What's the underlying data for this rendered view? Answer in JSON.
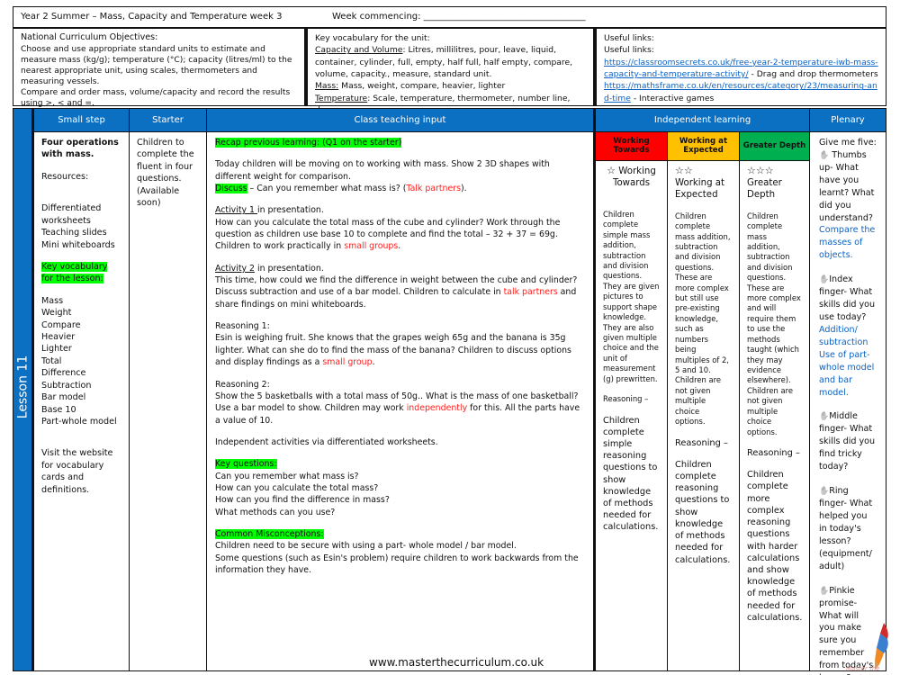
{
  "header": {
    "title": "Year 2 Summer – Mass, Capacity and Temperature week 3",
    "week_commencing_label": "Week commencing: ____________________________________"
  },
  "objectives": {
    "heading": "National Curriculum Objectives:",
    "lines": [
      "Choose and use appropriate standard units to estimate and measure mass (kg/g); temperature (°C); capacity (litres/ml) to the nearest appropriate unit, using scales, thermometers and measuring vessels.",
      "Compare and order mass, volume/capacity and record the results using >, < and =."
    ]
  },
  "unit_vocab": {
    "heading": "Key vocabulary for the unit:",
    "capacity_label": "Capacity and Volume",
    "capacity_text": ": Litres, millilitres, pour, leave, liquid, container, cylinder, full, empty, half full, half empty, compare, volume, capacity., measure, standard unit.",
    "mass_label": "Mass:",
    "mass_text": " Mass, weight, compare, heavier, lighter",
    "temperature_label": "Temperature",
    "temperature_text": ": Scale, temperature, thermometer, number line, degree"
  },
  "links": {
    "heading1": "Useful links:",
    "heading2": "Useful links:",
    "link1": "https://classroomsecrets.co.uk/free-year-2-temperature-iwb-mass-capacity-and-temperature-activity/",
    "link1_desc": " - Drag and drop thermometers",
    "link2": "https://mathsframe.co.uk/en/resources/category/23/measuring-and-time",
    "link2_desc": " - Interactive games"
  },
  "lesson_label": "Lesson 11",
  "columns": {
    "small_step": "Small step",
    "starter": "Starter",
    "teaching": "Class teaching input",
    "independent": "Independent learning",
    "plenary": "Plenary"
  },
  "small_step": {
    "title": "Four operations with mass.",
    "resources_label": "Resources:",
    "resources": [
      "Differentiated worksheets",
      "Teaching slides",
      "Mini whiteboards"
    ],
    "vocab_heading": "Key vocabulary for the lesson:",
    "vocab": [
      "Mass",
      "Weight",
      "Compare",
      "Heavier",
      "Lighter",
      "Total",
      "Difference",
      "Subtraction",
      "Bar model",
      "Base 10",
      "Part-whole model"
    ],
    "visit": "Visit the website for vocabulary cards and definitions."
  },
  "starter": {
    "text": "Children to complete the fluent in four questions. (Available soon)"
  },
  "teaching": {
    "recap": "Recap previous learning: (Q1 on the starter)",
    "intro": "Today children will be moving on to working with mass. Show 2 3D shapes with different weight for comparison.",
    "discuss_label": "Discuss",
    "discuss_text": " – Can you remember what mass is? (",
    "discuss_red": "Talk partners",
    "discuss_end": ").",
    "act1_label": "Activity 1 ",
    "act1_title_rest": "in presentation.",
    "act1_text": "How can you calculate the total mass of the cube and cylinder? Work through the question as children use base 10 to complete and find the total – 32 + 37 = 69g. Children to work practically in ",
    "act1_red": "small groups",
    "act1_end": ".",
    "act2_label": "Activity 2",
    "act2_title_rest": " in presentation.",
    "act2_text": "This time, how could we find the difference in weight between the cube and cylinder? Discuss subtraction and use of a bar model. Children to calculate in ",
    "act2_red": "talk partners",
    "act2_end": " and share findings on mini whiteboards.",
    "r1_title": "Reasoning 1:",
    "r1_text": "Esin is weighing fruit. She knows that the grapes weigh 65g and the banana is 35g lighter. What can she do to find the mass of the banana? Children to discuss options and display findings as a ",
    "r1_red": "small group",
    "r1_end": ".",
    "r2_title": "Reasoning 2:",
    "r2_text": "Show the 5 basketballs with a total mass of 50g.. What is the mass of one basketball? Use a bar model to show. Children may work ",
    "r2_red": "independently",
    "r2_end": " for this. All the parts have a value of 10.",
    "independent": "Independent activities via differentiated worksheets.",
    "kq_heading": "Key questions:",
    "key_questions": [
      "Can you remember what mass is?",
      "How can you calculate the total mass?",
      "How can you find the difference in mass?",
      "What methods can you use?"
    ],
    "cm_heading": "Common Misconceptions:",
    "misconceptions": [
      "Children need to be secure with using a part- whole model / bar model.",
      "Some questions (such as Esin's problem) require children to work backwards from the information they have."
    ]
  },
  "independent": {
    "groups": [
      {
        "header": "Working Towards",
        "color": "#ff0000",
        "stars": "☆",
        "title": "Working Towards",
        "text": "Children complete simple mass addition, subtraction and division questions. They are given pictures to support shape knowledge. They are also given multiple choice and the unit of measurement (g) prewritten.",
        "reasoning_label": "Reasoning –",
        "reasoning_text": "Children complete simple reasoning questions to show knowledge of methods needed for calculations."
      },
      {
        "header": "Working at Expected",
        "color": "#ffc000",
        "stars": "☆☆",
        "title": "Working at Expected",
        "text": "Children complete mass addition, subtraction and division questions. These are more complex but still use pre-existing knowledge, such as numbers being multiples of 2, 5 and 10. Children are not given multiple choice options.",
        "reasoning_label": "Reasoning –",
        "reasoning_text": "Children complete reasoning questions to show knowledge of methods needed for calculations."
      },
      {
        "header": "Greater Depth",
        "color": "#00b050",
        "stars": "☆☆☆",
        "title": "Greater Depth",
        "text": "Children complete mass addition, subtraction and division questions. These are more complex and will require them to use the methods taught (which they may evidence elsewhere). Children are not given multiple choice options.",
        "reasoning_label": "Reasoning –",
        "reasoning_text": "Children complete more complex reasoning questions with harder calculations and show knowledge of methods needed for calculations."
      }
    ]
  },
  "plenary": {
    "intro": "Give me five:",
    "items": [
      {
        "icon": "hand-icon",
        "text": " Thumbs up- What have you learnt? What did you understand?",
        "answer": "Compare the masses of objects."
      },
      {
        "icon": "hand-icon",
        "text": "Index finger- What skills did you use today?",
        "answer": "Addition/ subtraction Use of part-whole model and bar model."
      },
      {
        "icon": "hand-icon",
        "text": "Middle finger- What skills did you find tricky today?",
        "answer": ""
      },
      {
        "icon": "hand-icon",
        "text": "Ring finger- What helped you in today's lesson? (equipment/ adult)",
        "answer": ""
      },
      {
        "icon": "hand-icon",
        "text": "Pinkie promise- What will you make sure you remember from today's lesson?",
        "answer": ""
      }
    ]
  },
  "footer": {
    "url": "www.masterthecurriculum.co.uk",
    "logo_text": "Master the Curriculum"
  },
  "colors": {
    "header_blue": "#0b6fc2",
    "highlight_green": "#00ff00",
    "emphasis_red": "#ff2020",
    "link_blue": "#0b62c4"
  }
}
